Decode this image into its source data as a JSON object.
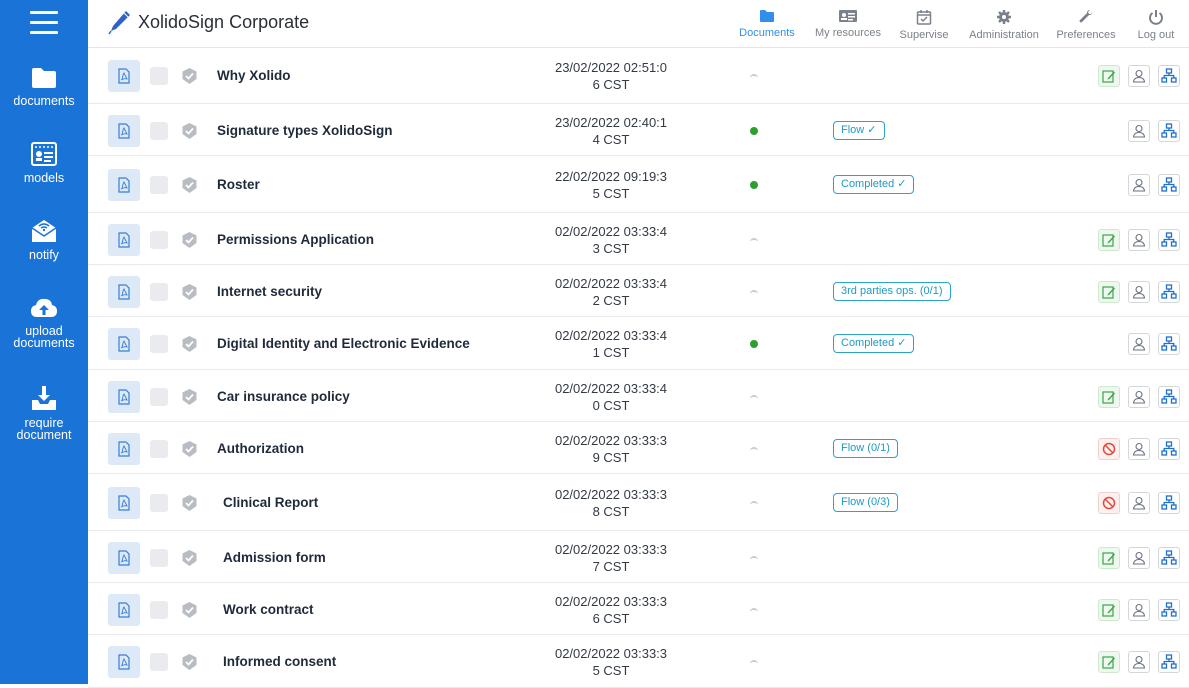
{
  "app": {
    "title": "XolidoSign Corporate"
  },
  "sidebar": {
    "items": [
      {
        "label": "documents",
        "icon": "folder-icon"
      },
      {
        "label": "models",
        "icon": "id-card-icon"
      },
      {
        "label": "notify",
        "icon": "notify-envelope-icon"
      },
      {
        "label": "upload documents",
        "icon": "cloud-upload-icon"
      },
      {
        "label": "require document",
        "icon": "inbox-download-icon"
      }
    ]
  },
  "topnav": {
    "items": [
      {
        "label": "Documents",
        "icon": "folder-icon",
        "active": true
      },
      {
        "label": "My resources",
        "icon": "id-card-icon",
        "active": false
      },
      {
        "label": "Supervise",
        "icon": "calendar-check-icon",
        "active": false
      },
      {
        "label": "Administration",
        "icon": "gear-icon",
        "active": false
      },
      {
        "label": "Preferences",
        "icon": "wrench-icon",
        "active": false
      },
      {
        "label": "Log out",
        "icon": "power-icon",
        "active": false
      }
    ]
  },
  "colors": {
    "sidebar": "#1a73d6",
    "accent": "#2f8fea",
    "status_ok": "#2ca02c",
    "badge": "#1e9bc2",
    "block": "#e04a3a",
    "edit": "#3aa64a"
  },
  "documents": [
    {
      "title": "Why Xolido",
      "date_line1": "23/02/2022 02:51:0",
      "date_line2": "6 CST",
      "status": "pending",
      "badge": "",
      "first_action": "edit"
    },
    {
      "title": "Signature types XolidoSign",
      "date_line1": "23/02/2022 02:40:1",
      "date_line2": "4 CST",
      "status": "ok",
      "badge": "Flow ✓",
      "first_action": ""
    },
    {
      "title": "Roster",
      "date_line1": "22/02/2022 09:19:3",
      "date_line2": "5 CST",
      "status": "ok",
      "badge": "Completed ✓",
      "first_action": ""
    },
    {
      "title": "Permissions Application",
      "date_line1": "02/02/2022 03:33:4",
      "date_line2": "3 CST",
      "status": "pending",
      "badge": "",
      "first_action": "edit"
    },
    {
      "title": "Internet security",
      "date_line1": "02/02/2022 03:33:4",
      "date_line2": "2 CST",
      "status": "pending",
      "badge": "3rd parties ops. (0/1)",
      "first_action": "edit"
    },
    {
      "title": "Digital Identity and Electronic Evidence",
      "date_line1": "02/02/2022 03:33:4",
      "date_line2": "1 CST",
      "status": "ok",
      "badge": "Completed ✓",
      "first_action": ""
    },
    {
      "title": "Car insurance policy",
      "date_line1": "02/02/2022 03:33:4",
      "date_line2": "0 CST",
      "status": "pending",
      "badge": "",
      "first_action": "edit"
    },
    {
      "title": "Authorization",
      "date_line1": "02/02/2022 03:33:3",
      "date_line2": "9 CST",
      "status": "pending",
      "badge": "Flow (0/1)",
      "first_action": "block"
    },
    {
      "title": "Clinical Report",
      "date_line1": "02/02/2022 03:33:3",
      "date_line2": "8 CST",
      "status": "pending",
      "badge": "Flow (0/3)",
      "first_action": "block"
    },
    {
      "title": "Admission form",
      "date_line1": "02/02/2022 03:33:3",
      "date_line2": "7 CST",
      "status": "pending",
      "badge": "",
      "first_action": "edit"
    },
    {
      "title": "Work contract",
      "date_line1": "02/02/2022 03:33:3",
      "date_line2": "6 CST",
      "status": "pending",
      "badge": "",
      "first_action": "edit"
    },
    {
      "title": "Informed consent",
      "date_line1": "02/02/2022 03:33:3",
      "date_line2": "5 CST",
      "status": "pending",
      "badge": "",
      "first_action": "edit"
    }
  ]
}
